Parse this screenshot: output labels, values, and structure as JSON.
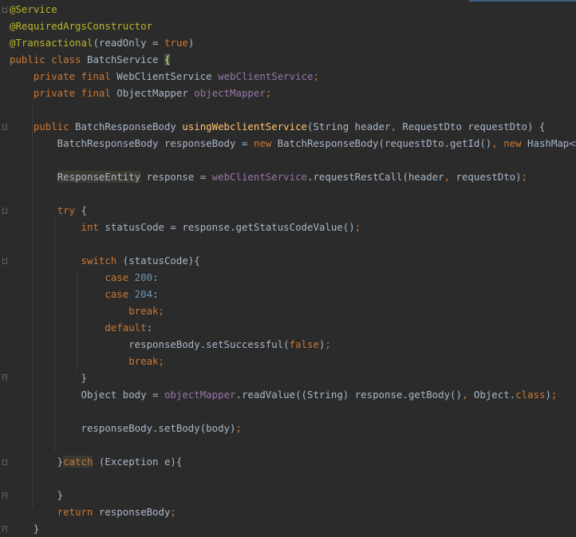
{
  "colors": {
    "background": "#2b2b2b",
    "text": "#a9b7c6",
    "keyword": "#cc7832",
    "annotation": "#bbb529",
    "field": "#9876aa",
    "method": "#ffc66d",
    "number": "#6897bb"
  },
  "code": {
    "l1": [
      {
        "t": "@Service",
        "c": "ann"
      }
    ],
    "l2": [
      {
        "t": "@RequiredArgsConstructor",
        "c": "ann"
      }
    ],
    "l3": [
      {
        "t": "@Transactional",
        "c": "ann"
      },
      {
        "t": "(readOnly = "
      },
      {
        "t": "true",
        "c": "kw"
      },
      {
        "t": ")"
      }
    ],
    "l4": [
      {
        "t": "public class ",
        "c": "kw"
      },
      {
        "t": "BatchService "
      },
      {
        "t": "{",
        "c": "bracehl"
      }
    ],
    "l5": [
      {
        "t": "    "
      },
      {
        "t": "private final ",
        "c": "kw"
      },
      {
        "t": "WebClientService "
      },
      {
        "t": "webClientService",
        "c": "fld"
      },
      {
        "t": ";",
        "c": "kw"
      }
    ],
    "l6": [
      {
        "t": "    "
      },
      {
        "t": "private final ",
        "c": "kw"
      },
      {
        "t": "ObjectMapper "
      },
      {
        "t": "objectMapper",
        "c": "fld"
      },
      {
        "t": ";",
        "c": "kw"
      }
    ],
    "l7": [],
    "l8": [
      {
        "t": "    "
      },
      {
        "t": "public ",
        "c": "kw"
      },
      {
        "t": "BatchResponseBody "
      },
      {
        "t": "usingWebclientService",
        "c": "mth"
      },
      {
        "t": "(String header"
      },
      {
        "t": ", ",
        "c": "kw"
      },
      {
        "t": "RequestDto requestDto) {"
      }
    ],
    "l9": [
      {
        "t": "        BatchResponseBody responseBody = "
      },
      {
        "t": "new ",
        "c": "kw"
      },
      {
        "t": "BatchResponseBody(requestDto.getId()"
      },
      {
        "t": ", ",
        "c": "kw"
      },
      {
        "t": "new ",
        "c": "kw"
      },
      {
        "t": "HashMap<>())"
      },
      {
        "t": ";",
        "c": "kw"
      }
    ],
    "l10": [],
    "l11": [
      {
        "t": "        "
      },
      {
        "t": "ResponseEntity",
        "c": "hl"
      },
      {
        "t": " response = "
      },
      {
        "t": "webClientService",
        "c": "fld"
      },
      {
        "t": ".requestRestCall(header"
      },
      {
        "t": ", ",
        "c": "kw"
      },
      {
        "t": "requestDto)"
      },
      {
        "t": ";",
        "c": "kw"
      }
    ],
    "l12": [],
    "l13": [
      {
        "t": "        "
      },
      {
        "t": "try ",
        "c": "kw"
      },
      {
        "t": "{"
      }
    ],
    "l14": [
      {
        "t": "            "
      },
      {
        "t": "int ",
        "c": "kw"
      },
      {
        "t": "statusCode = response.getStatusCodeValue()"
      },
      {
        "t": ";",
        "c": "kw"
      }
    ],
    "l15": [],
    "l16": [
      {
        "t": "            "
      },
      {
        "t": "switch ",
        "c": "kw"
      },
      {
        "t": "(statusCode){"
      }
    ],
    "l17": [
      {
        "t": "                "
      },
      {
        "t": "case ",
        "c": "kw"
      },
      {
        "t": "200",
        "c": "num"
      },
      {
        "t": ":"
      }
    ],
    "l18": [
      {
        "t": "                "
      },
      {
        "t": "case ",
        "c": "kw"
      },
      {
        "t": "204",
        "c": "num"
      },
      {
        "t": ":"
      }
    ],
    "l19": [
      {
        "t": "                    "
      },
      {
        "t": "break;",
        "c": "kw"
      }
    ],
    "l20": [
      {
        "t": "                "
      },
      {
        "t": "default",
        "c": "kw"
      },
      {
        "t": ":"
      }
    ],
    "l21": [
      {
        "t": "                    responseBody.setSuccessful("
      },
      {
        "t": "false",
        "c": "kw"
      },
      {
        "t": ")"
      },
      {
        "t": ";",
        "c": "kw"
      }
    ],
    "l22": [
      {
        "t": "                    "
      },
      {
        "t": "break;",
        "c": "kw"
      }
    ],
    "l23": [
      {
        "t": "            }"
      }
    ],
    "l24": [
      {
        "t": "            Object body = "
      },
      {
        "t": "objectMapper",
        "c": "fld"
      },
      {
        "t": ".readValue((String) response.getBody()"
      },
      {
        "t": ", ",
        "c": "kw"
      },
      {
        "t": "Object."
      },
      {
        "t": "class",
        "c": "kw"
      },
      {
        "t": ")"
      },
      {
        "t": ";",
        "c": "kw"
      }
    ],
    "l25": [],
    "l26": [
      {
        "t": "            responseBody.setBody(body)"
      },
      {
        "t": ";",
        "c": "kw"
      }
    ],
    "l27": [],
    "l28": [
      {
        "t": "        }"
      },
      {
        "t": "catch",
        "c": "kw hl"
      },
      {
        "t": " (Exception e){"
      }
    ],
    "l29": [],
    "l30": [
      {
        "t": "        }"
      }
    ],
    "l31": [
      {
        "t": "        "
      },
      {
        "t": "return ",
        "c": "kw"
      },
      {
        "t": "responseBody"
      },
      {
        "t": ";",
        "c": "kw"
      }
    ],
    "l32": [
      {
        "t": "    }"
      }
    ]
  }
}
